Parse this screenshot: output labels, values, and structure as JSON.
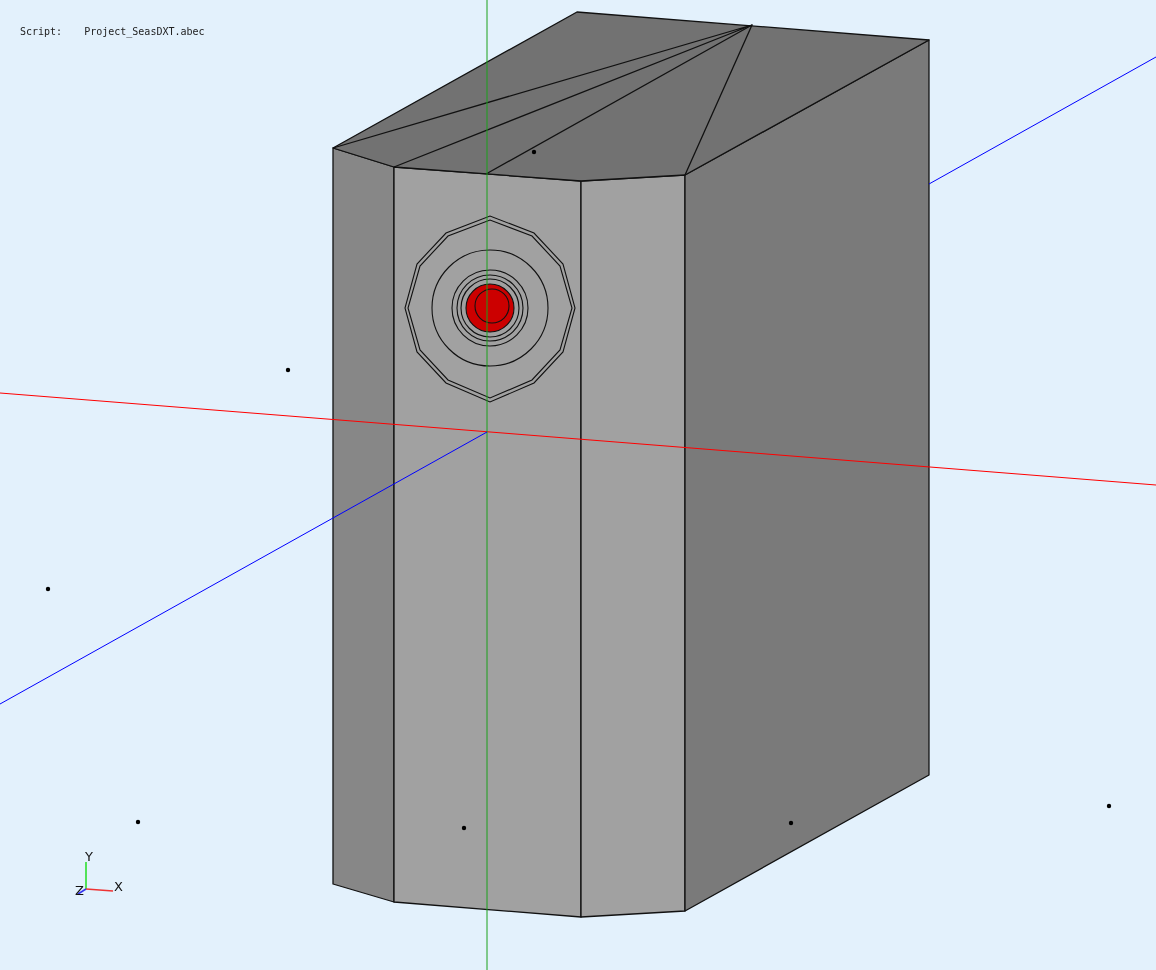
{
  "header": {
    "script_label": "Script:",
    "script_file": "Project_SeasDXT.abec"
  },
  "axis_triad": {
    "y_label": "Y",
    "z_label": "Z",
    "x_label": "X"
  }
}
